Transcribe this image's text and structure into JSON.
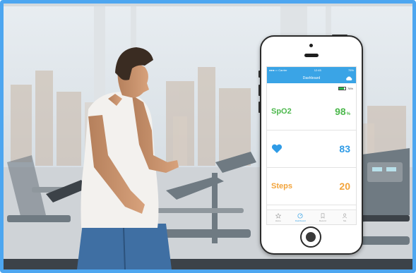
{
  "colors": {
    "frame": "#4da6f0",
    "header": "#3aa4e6",
    "spo2": "#4cb84c",
    "heart": "#2f9be6",
    "steps": "#f2a33a",
    "battery": "#2db84b"
  },
  "phone": {
    "status": {
      "carrier": "●●●○○ Carrier",
      "time": "12:45",
      "battery": "75%"
    },
    "header": {
      "title": "Dashboard",
      "icon": "cloud-icon"
    },
    "battery_level": {
      "fraction": 0.76,
      "label": "76%"
    },
    "metrics": [
      {
        "label": "SpO2",
        "value": "98",
        "unit": "%"
      },
      {
        "icon": "heart-icon",
        "value": "83"
      },
      {
        "label": "Steps",
        "value": "20"
      }
    ],
    "tabs": [
      {
        "label": "Home",
        "icon": "star-icon"
      },
      {
        "label": "Dashboard",
        "icon": "gauge-icon"
      },
      {
        "label": "Record",
        "icon": "bookmark-icon"
      },
      {
        "label": "Me",
        "icon": "person-icon"
      }
    ]
  }
}
